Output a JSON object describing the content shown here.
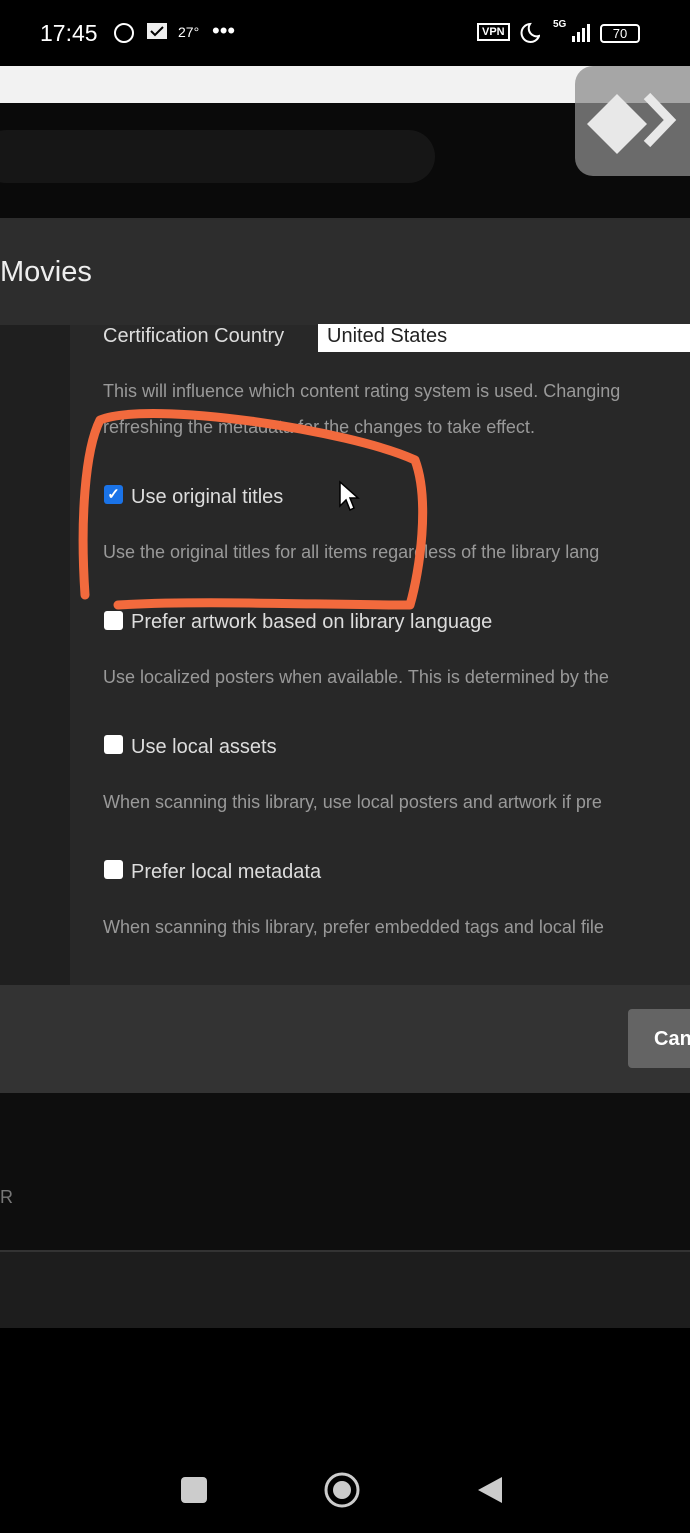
{
  "status_bar": {
    "time": "17:45",
    "temperature": "27°",
    "more": "•••",
    "vpn": "VPN",
    "network": "5G",
    "battery": "70"
  },
  "dialog": {
    "title": "Movies",
    "certification": {
      "label": "Certification Country",
      "value": "United States",
      "description": "This will influence which content rating system is used. Changing",
      "description2": "refreshing the metadata for the changes to take effect."
    },
    "options": [
      {
        "label": "Use original titles",
        "checked": true,
        "description": "Use the original titles for all items regardless of the library lang"
      },
      {
        "label": "Prefer artwork based on library language",
        "checked": false,
        "description": "Use localized posters when available. This is determined by the"
      },
      {
        "label": "Use local assets",
        "checked": false,
        "description": "When scanning this library, use local posters and artwork if pre"
      },
      {
        "label": "Prefer local metadata",
        "checked": false,
        "description": "When scanning this library, prefer embedded tags and local file"
      }
    ],
    "cancel_label": "Can"
  },
  "background": {
    "letter": "R"
  },
  "colors": {
    "annotation": "#f26a3d",
    "checkbox": "#1a73e8"
  }
}
